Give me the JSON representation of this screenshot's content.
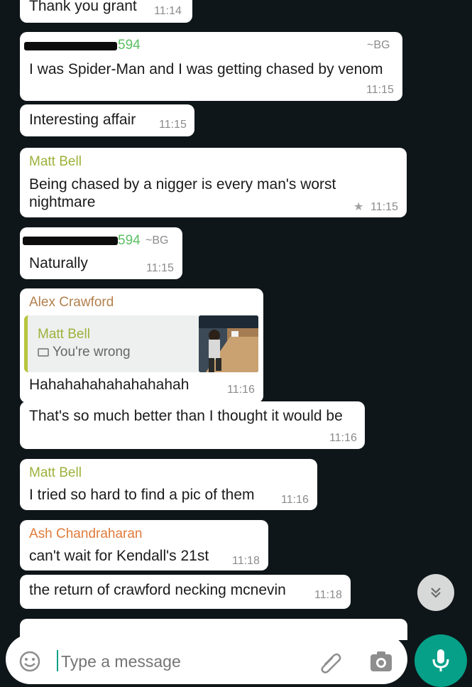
{
  "messages": [
    {
      "text": "Thank you grant",
      "time": "11:14"
    },
    {
      "sender_suffix": "594",
      "tag": "~BG",
      "text": "I was Spider-Man and I was getting chased by venom",
      "time": "11:15"
    },
    {
      "text": "Interesting affair",
      "time": "11:15"
    },
    {
      "sender": "Matt Bell",
      "text_line1": "Being chased by a nigger is every man's worst",
      "text_line2": "nightmare",
      "time": "11:15"
    },
    {
      "sender_suffix": "594",
      "tag": "~BG",
      "text": "Naturally",
      "time": "11:15"
    },
    {
      "sender": "Alex Crawford",
      "quote_sender": "Matt Bell",
      "quote_text": "You're wrong",
      "text": "Hahahahahahahahahah",
      "time": "11:16"
    },
    {
      "text": "That's so much better than I thought it would be",
      "time": "11:16"
    },
    {
      "sender": "Matt Bell",
      "text": "I tried so hard to find a pic of them",
      "time": "11:16"
    },
    {
      "sender": "Ash Chandraharan",
      "text": "can't wait for Kendall's 21st",
      "time": "11:18"
    },
    {
      "text": "the return of crawford necking mcnevin",
      "time": "11:18"
    }
  ],
  "composer": {
    "placeholder": "Type a message",
    "emoji_icon": "emoji-icon",
    "attach_icon": "paperclip-icon",
    "camera_icon": "camera-icon",
    "mic_icon": "microphone-icon"
  },
  "colors": {
    "background": "#0f1619",
    "bubble": "#ffffff",
    "time": "#8b8b8b",
    "sender_green": "#5bbf63",
    "sender_olive": "#9bb23a",
    "sender_brown": "#b2804e",
    "sender_orange": "#e07b3a",
    "accent": "#06a088"
  }
}
